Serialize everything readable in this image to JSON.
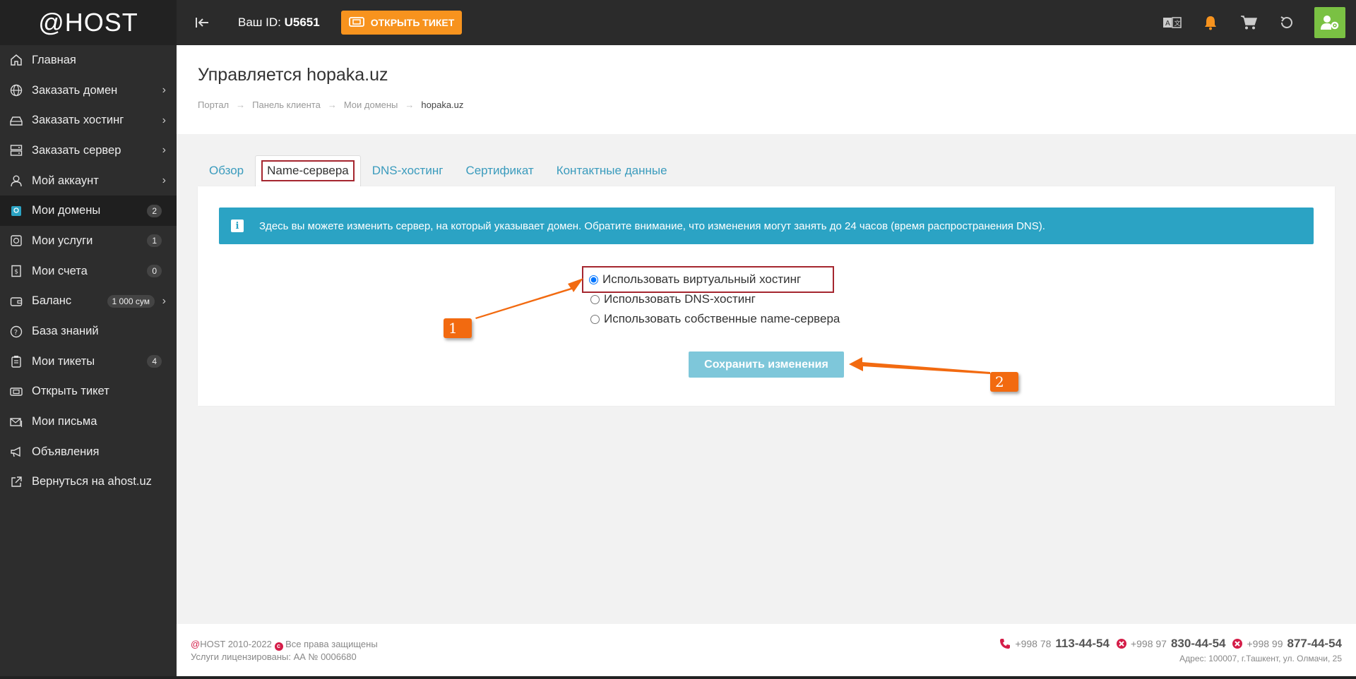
{
  "app": {
    "logo": "@HOST"
  },
  "sidebar": {
    "items": [
      {
        "label": "Главная",
        "icon": "home-icon",
        "badge": "",
        "chevron": false
      },
      {
        "label": "Заказать домен",
        "icon": "globe-icon",
        "badge": "",
        "chevron": true
      },
      {
        "label": "Заказать хостинг",
        "icon": "hdd-icon",
        "badge": "",
        "chevron": true
      },
      {
        "label": "Заказать сервер",
        "icon": "server-icon",
        "badge": "",
        "chevron": true
      },
      {
        "label": "Мой аккаунт",
        "icon": "user-icon",
        "badge": "",
        "chevron": true
      },
      {
        "label": "Мои домены",
        "icon": "domain-icon",
        "badge": "2",
        "chevron": false,
        "active": true
      },
      {
        "label": "Мои услуги",
        "icon": "box-icon",
        "badge": "1",
        "chevron": false
      },
      {
        "label": "Мои счета",
        "icon": "invoice-icon",
        "badge": "0",
        "chevron": false
      },
      {
        "label": "Баланс",
        "icon": "wallet-icon",
        "badge": "1 000 сум",
        "chevron": true
      },
      {
        "label": "База знаний",
        "icon": "question-icon",
        "badge": "",
        "chevron": false
      },
      {
        "label": "Мои тикеты",
        "icon": "clipboard-icon",
        "badge": "4",
        "chevron": false
      },
      {
        "label": "Открыть тикет",
        "icon": "ticket-icon",
        "badge": "",
        "chevron": false
      },
      {
        "label": "Мои письма",
        "icon": "mail-icon",
        "badge": "",
        "chevron": false
      },
      {
        "label": "Объявления",
        "icon": "megaphone-icon",
        "badge": "",
        "chevron": false
      },
      {
        "label": "Вернуться на ahost.uz",
        "icon": "external-link-icon",
        "badge": "",
        "chevron": false
      }
    ]
  },
  "topbar": {
    "id_label": "Ваш ID:",
    "id_value": "U5651",
    "ticket_button": "Открыть тикет"
  },
  "header": {
    "title": "Управляется hopaka.uz",
    "breadcrumb": [
      "Портал",
      "Панель клиента",
      "Мои домены",
      "hopaka.uz"
    ]
  },
  "tabs": [
    "Обзор",
    "Name-сервера",
    "DNS-хостинг",
    "Сертификат",
    "Контактные данные"
  ],
  "alert": "Здесь вы можете изменить сервер, на который указывает домен. Обратите внимание, что изменения могут занять до 24 часов (время распространения DNS).",
  "options": [
    {
      "label": "Использовать виртуальный хостинг",
      "checked": true
    },
    {
      "label": "Использовать DNS-хостинг",
      "checked": false
    },
    {
      "label": "Использовать собственные name-сервера",
      "checked": false
    }
  ],
  "save_button": "Сохранить изменения",
  "annotations": {
    "marker1": "1",
    "marker2": "2"
  },
  "footer": {
    "brand": "@",
    "copy": "HOST 2010-2022",
    "rights": "Все права защищены",
    "license": "Услуги лицензированы: АА № 0006680",
    "phones": [
      {
        "prefix": "+998 78",
        "number": "113-44-54"
      },
      {
        "prefix": "+998 97",
        "number": "830-44-54"
      },
      {
        "prefix": "+998 99",
        "number": "877-44-54"
      }
    ],
    "address": "Адрес: 100007, г.Ташкент, ул. Олмачи, 25"
  },
  "colors": {
    "accent": "#f7931e",
    "link": "#3a9bbd",
    "alert": "#2ba3c4",
    "annotation": "#f26a10",
    "highlight": "#a5262f"
  }
}
